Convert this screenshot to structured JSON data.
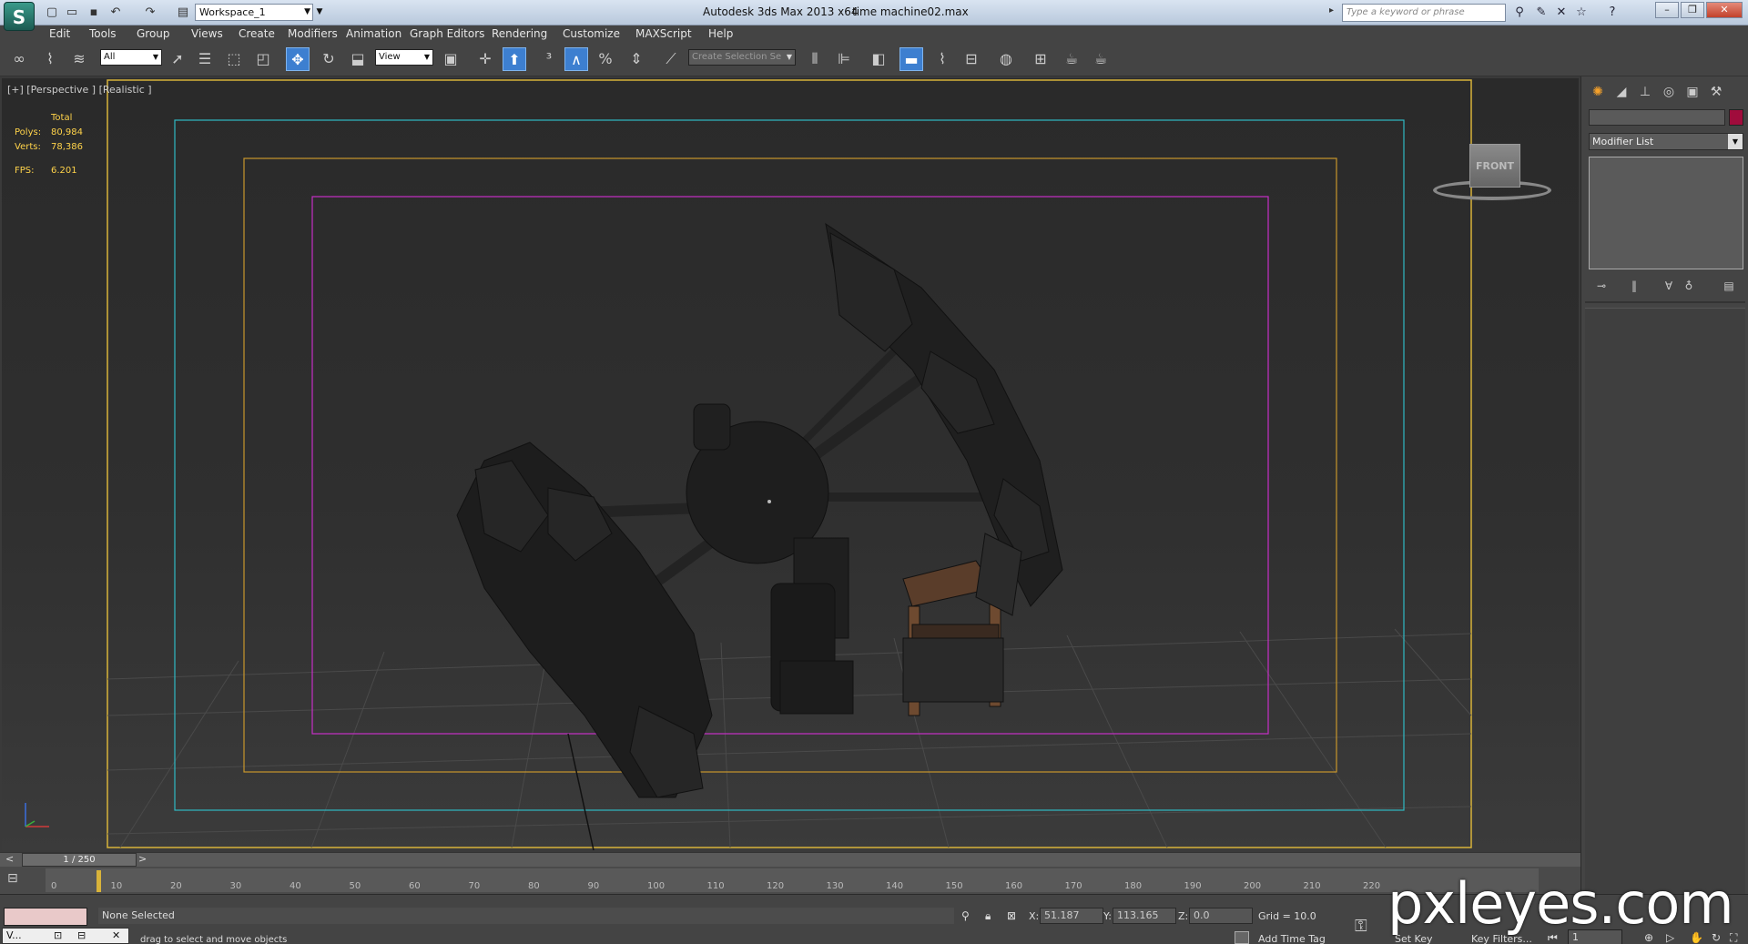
{
  "titlebar": {
    "workspace": "Workspace_1",
    "app_title": "Autodesk 3ds Max  2013 x64",
    "file_title": "time machine02.max",
    "search_placeholder": "Type a keyword or phrase",
    "icons": [
      "new-icon",
      "open-icon",
      "save-icon",
      "undo-icon",
      "redo-icon",
      "project-folder-icon"
    ],
    "right_icons": [
      "binoculars-icon",
      "search-icon",
      "communication-center-icon",
      "favorites-icon",
      "help-icon"
    ]
  },
  "menu": [
    "Edit",
    "Tools",
    "Group",
    "Views",
    "Create",
    "Modifiers",
    "Animation",
    "Graph Editors",
    "Rendering",
    "Customize",
    "MAXScript",
    "Help"
  ],
  "toolbar": {
    "selection_filter": "All",
    "ref_coord": "View",
    "named_selection": "Create Selection Se"
  },
  "viewport": {
    "label": "[+] [Perspective ] [Realistic ]",
    "stats": {
      "total_label": "Total",
      "polys_label": "Polys:",
      "polys": "80,984",
      "verts_label": "Verts:",
      "verts": "78,386",
      "fps_label": "FPS:",
      "fps": "6.201"
    },
    "viewcube_face": "FRONT"
  },
  "command_panel": {
    "modifier_list": "Modifier List",
    "object_color": "#a00c3c"
  },
  "time_slider": {
    "position": "1 / 250",
    "prev": "<",
    "next": ">"
  },
  "trackbar": {
    "ticks": [
      "0",
      "10",
      "20",
      "30",
      "40",
      "50",
      "60",
      "70",
      "80",
      "90",
      "100",
      "110",
      "120",
      "130",
      "140",
      "150",
      "160",
      "170",
      "180",
      "190",
      "200",
      "210",
      "220"
    ]
  },
  "statusbar": {
    "selection": "None Selected",
    "prompt": "drag to select and move objects",
    "x_label": "X:",
    "x": "51.187",
    "y_label": "Y:",
    "y": "113.165",
    "z_label": "Z:",
    "z": "0.0",
    "grid": "Grid = 10.0",
    "add_time_tag": "Add Time Tag",
    "set_key": "Set Key",
    "key_filters": "Key Filters...",
    "frame": "1",
    "tab_label": "V..."
  },
  "watermark": "pxleyes.com"
}
